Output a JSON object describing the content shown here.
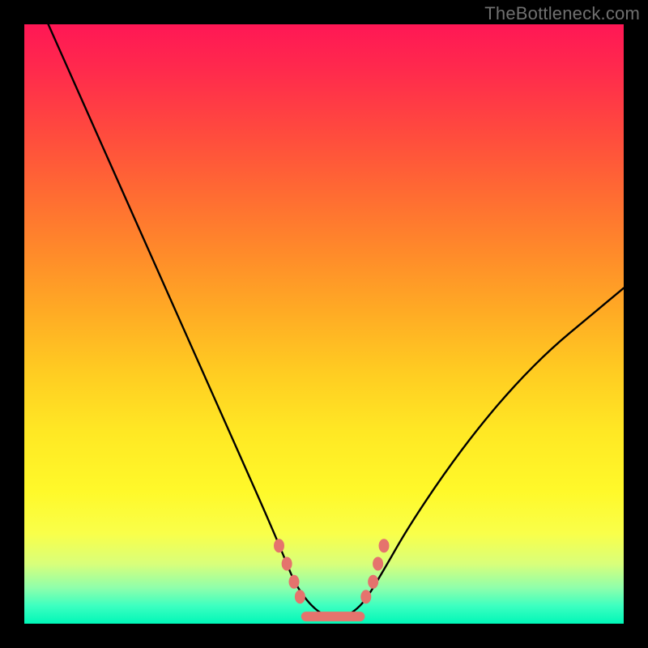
{
  "watermark": "TheBottleneck.com",
  "colors": {
    "curve": "#000000",
    "dots": "#e5736d",
    "flat": "#e5736d"
  },
  "chart_data": {
    "type": "line",
    "title": "",
    "xlabel": "",
    "ylabel": "",
    "xlim": [
      0,
      100
    ],
    "ylim": [
      0,
      100
    ],
    "description": "V-shaped bottleneck curve over vertical rainbow gradient; valley near x≈50, y≈1",
    "series": [
      {
        "name": "bottleneck",
        "x": [
          4,
          8,
          12,
          16,
          20,
          24,
          28,
          32,
          36,
          40,
          43,
          45,
          47,
          49,
          51,
          53,
          55,
          57,
          60,
          64,
          70,
          76,
          82,
          88,
          94,
          100
        ],
        "y": [
          100,
          91,
          82,
          73,
          64,
          55,
          46,
          37,
          28,
          19,
          12,
          7,
          4,
          2,
          1,
          1,
          2,
          4,
          9,
          16,
          25,
          33,
          40,
          46,
          51,
          56
        ]
      }
    ],
    "flat_segment": {
      "x0": 47,
      "x1": 56,
      "y": 1.2
    },
    "dots": [
      {
        "x": 42.5,
        "y": 13
      },
      {
        "x": 43.8,
        "y": 10
      },
      {
        "x": 45.0,
        "y": 7
      },
      {
        "x": 46.0,
        "y": 4.5
      },
      {
        "x": 57.0,
        "y": 4.5
      },
      {
        "x": 58.2,
        "y": 7
      },
      {
        "x": 59.0,
        "y": 10
      },
      {
        "x": 60.0,
        "y": 13
      }
    ]
  }
}
